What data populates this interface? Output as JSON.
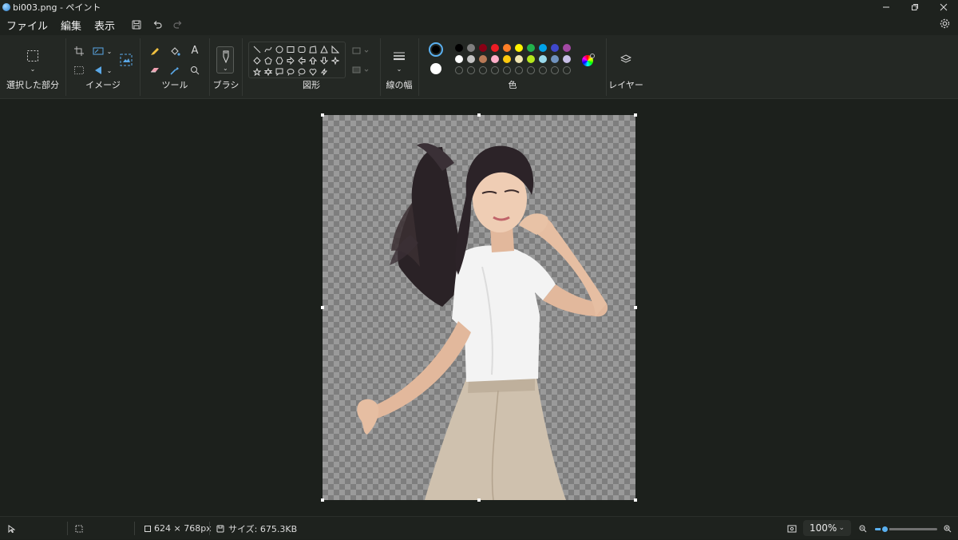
{
  "window": {
    "title": "bi003.png - ペイント"
  },
  "menu": {
    "file": "ファイル",
    "edit": "編集",
    "view": "表示"
  },
  "ribbon": {
    "selection_label": "選択した部分",
    "image_label": "イメージ",
    "tools_label": "ツール",
    "brush_label": "ブラシ",
    "shapes_label": "図形",
    "line_width_label": "線の幅",
    "colors_label": "色",
    "layers_label": "レイヤー",
    "text_tool": "A"
  },
  "colors": {
    "primary": "#000000",
    "secondary": "#ffffff",
    "row1": [
      "#000000",
      "#7f7f7f",
      "#880015",
      "#ed1c24",
      "#ff7f27",
      "#fff200",
      "#22b14c",
      "#00a2e8",
      "#3f48cc",
      "#a349a4"
    ],
    "row2": [
      "#ffffff",
      "#c3c3c3",
      "#b97a57",
      "#ffaec9",
      "#ffc90e",
      "#efe4b0",
      "#b5e61d",
      "#99d9ea",
      "#7092be",
      "#c8bfe7"
    ]
  },
  "status": {
    "canvas_size": "624 × 768px",
    "file_size": "サイズ: 675.3KB",
    "zoom": "100%",
    "zoom_fraction": 0.16
  }
}
